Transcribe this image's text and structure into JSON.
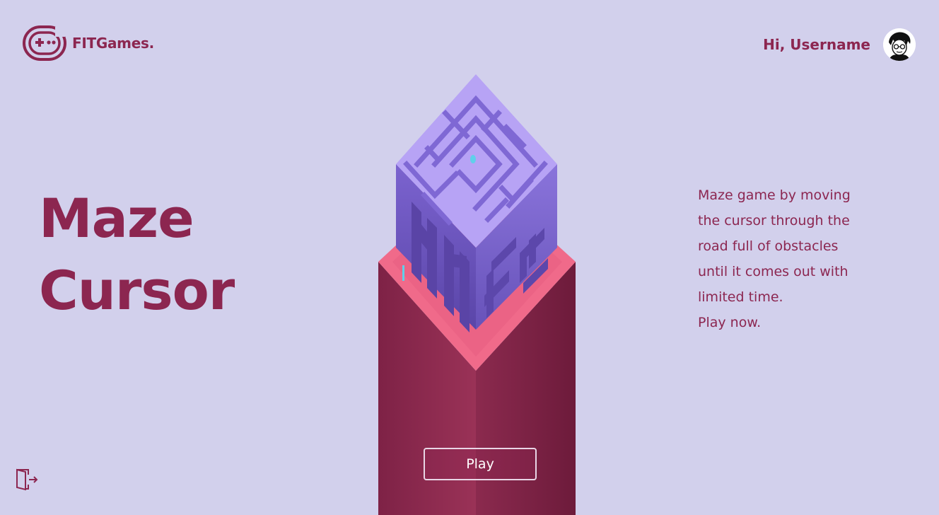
{
  "brand": {
    "name": "FITGames.",
    "logo_icon": "gamepad-icon"
  },
  "header": {
    "greeting": "Hi, Username"
  },
  "game": {
    "title_line1": "Maze",
    "title_line2": "Cursor",
    "art_icon": "maze-tower-illustration",
    "description_lines": [
      "Maze game by moving",
      "the cursor through the",
      "road full of obstacles",
      "until it comes out with",
      "limited time.",
      "Play now."
    ],
    "play_label": "Play"
  },
  "colors": {
    "background": "#d2d0ec",
    "accent": "#8c2650",
    "pedestal": "#7e2447",
    "pedestal_top": "#f06a8a",
    "maze_top": "#b09cf2",
    "maze_side": "#6a55bd"
  },
  "footer": {
    "logout_icon": "logout-icon"
  }
}
